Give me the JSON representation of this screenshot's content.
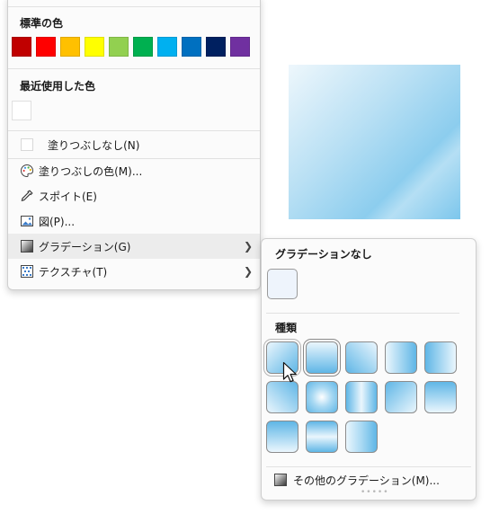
{
  "menu": {
    "standard_colors_label": "標準の色",
    "recent_colors_label": "最近使用した色",
    "standard_colors": [
      "#c00000",
      "#ff0000",
      "#ffc000",
      "#ffff00",
      "#92d050",
      "#00b050",
      "#00b0f0",
      "#0070c0",
      "#002060",
      "#7030a0"
    ],
    "items": [
      {
        "label": "塗りつぶしなし(N)",
        "icon": "no-fill-icon"
      },
      {
        "label": "塗りつぶしの色(M)...",
        "icon": "palette-icon"
      },
      {
        "label": "スポイト(E)",
        "icon": "eyedropper-icon"
      },
      {
        "label": "図(P)...",
        "icon": "picture-icon"
      },
      {
        "label": "グラデーション(G)",
        "icon": "gradient-icon",
        "has_submenu": true
      },
      {
        "label": "テクスチャ(T)",
        "icon": "texture-icon",
        "has_submenu": true
      }
    ]
  },
  "submenu": {
    "no_gradient_label": "グラデーションなし",
    "types_label": "種類",
    "more_label": "その他のグラデーション(M)..."
  }
}
